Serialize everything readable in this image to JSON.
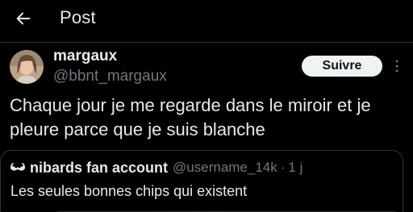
{
  "header": {
    "title": "Post",
    "back_icon": "arrow-left-icon"
  },
  "tweet": {
    "author_name": "margaux",
    "author_handle": "@bbnt_margaux",
    "follow_label": "Suivre",
    "more_icon": "more-vertical-icon",
    "text": "Chaque jour je me regarde dans le miroir et je pleure parce que je suis blanche"
  },
  "quote": {
    "icon": "moustache-avatar-icon",
    "author_name": "nibards fan account",
    "author_handle": "@username_14k",
    "separator": "·",
    "time": "1 j",
    "text": "Les seules bonnes chips qui existent"
  },
  "colors": {
    "background": "#000000",
    "primary_text": "#e7e9ea",
    "secondary_text": "#71767b",
    "border": "#2f3336",
    "follow_bg": "#eff3f4"
  }
}
